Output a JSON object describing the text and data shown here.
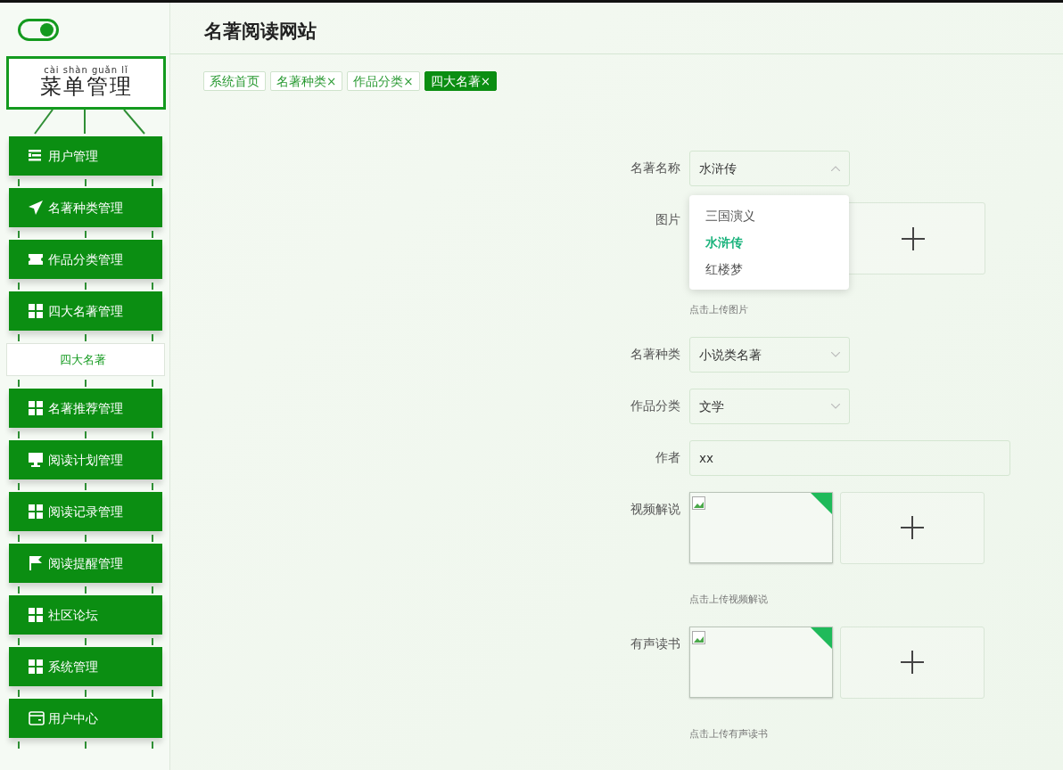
{
  "toggle": {
    "on": true
  },
  "menu_title": {
    "pinyin": "cài shàn guǎn lǐ",
    "text": "菜单管理"
  },
  "sidebar": {
    "items": [
      {
        "label": "用户管理",
        "kind": "group"
      },
      {
        "label": "名著种类管理",
        "kind": "group"
      },
      {
        "label": "作品分类管理",
        "kind": "group"
      },
      {
        "label": "四大名著管理",
        "kind": "group"
      },
      {
        "label": "四大名著",
        "kind": "sub"
      },
      {
        "label": "名著推荐管理",
        "kind": "group"
      },
      {
        "label": "阅读计划管理",
        "kind": "group"
      },
      {
        "label": "阅读记录管理",
        "kind": "group"
      },
      {
        "label": "阅读提醒管理",
        "kind": "group"
      },
      {
        "label": "社区论坛",
        "kind": "group"
      },
      {
        "label": "系统管理",
        "kind": "group"
      },
      {
        "label": "用户中心",
        "kind": "group"
      }
    ]
  },
  "site_title": "名著阅读网站",
  "tabs": [
    {
      "label": "系统首页",
      "selected": false
    },
    {
      "label": "名著种类",
      "close_mark": "×",
      "selected": false
    },
    {
      "label": "作品分类",
      "close_mark": "×",
      "selected": false
    },
    {
      "label": "四大名著",
      "close_mark": "×",
      "selected": true
    }
  ],
  "form": {
    "fields": [
      {
        "kind": "select",
        "label": "名著名称",
        "value": "水浒传",
        "expanded": true,
        "options": [
          {
            "label": "三国演义",
            "selected": false
          },
          {
            "label": "水浒传",
            "selected": true
          },
          {
            "label": "红楼梦",
            "selected": false
          }
        ]
      },
      {
        "kind": "upload",
        "label": "图片",
        "hint": "点击上传图片"
      },
      {
        "kind": "select",
        "label": "名著种类",
        "value": "小说类名著",
        "expanded": false
      },
      {
        "kind": "select",
        "label": "作品分类",
        "value": "文学",
        "expanded": false
      },
      {
        "kind": "text",
        "label": "作者",
        "value": "xx"
      },
      {
        "kind": "upload",
        "label": "视频解说",
        "has_preview": true,
        "hint": "点击上传视频解说"
      },
      {
        "kind": "upload",
        "label": "有声读书",
        "has_preview": true,
        "hint": "点击上传有声读书"
      }
    ]
  }
}
